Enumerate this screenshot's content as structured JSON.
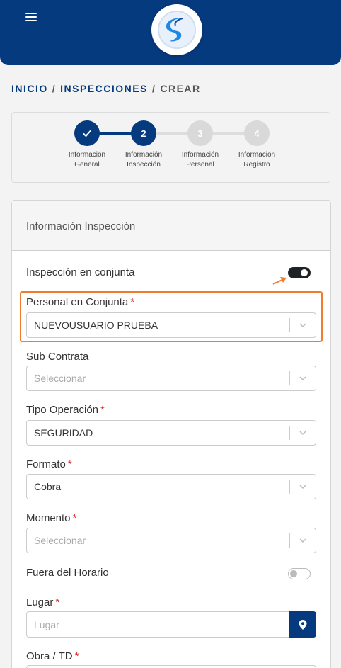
{
  "breadcrumb": {
    "home": "INICIO",
    "section": "INSPECCIONES",
    "current": "CREAR",
    "separator": "/"
  },
  "stepper": {
    "steps": [
      {
        "number": "",
        "line1": "Información",
        "line2": "General",
        "state": "done"
      },
      {
        "number": "2",
        "line1": "Información",
        "line2": "Inspección",
        "state": "current"
      },
      {
        "number": "3",
        "line1": "Información",
        "line2": "Personal",
        "state": "pending"
      },
      {
        "number": "4",
        "line1": "Información",
        "line2": "Registro",
        "state": "pending"
      }
    ]
  },
  "card": {
    "title": "Información Inspección"
  },
  "form": {
    "conjunta_label": "Inspección en conjunta",
    "conjunta_on": true,
    "personal_label": "Personal en Conjunta",
    "personal_value": "NUEVOUSUARIO PRUEBA",
    "subcontrata_label": "Sub Contrata",
    "subcontrata_placeholder": "Seleccionar",
    "tipo_label": "Tipo Operación",
    "tipo_value": "SEGURIDAD",
    "formato_label": "Formato",
    "formato_value": "Cobra",
    "momento_label": "Momento",
    "momento_placeholder": "Seleccionar",
    "fuera_label": "Fuera del Horario",
    "fuera_on": false,
    "lugar_label": "Lugar",
    "lugar_placeholder": "Lugar",
    "obra_label": "Obra / TD",
    "required_mark": "*"
  },
  "colors": {
    "brand": "#063a7e",
    "highlight": "#f07d2e",
    "required": "#d32f2f"
  },
  "icons": {
    "menu": "hamburger-icon",
    "logo": "brand-logo",
    "check": "check-icon",
    "chevron": "chevron-down-icon",
    "location": "map-pin-icon",
    "arrow": "arrow-annotation"
  }
}
